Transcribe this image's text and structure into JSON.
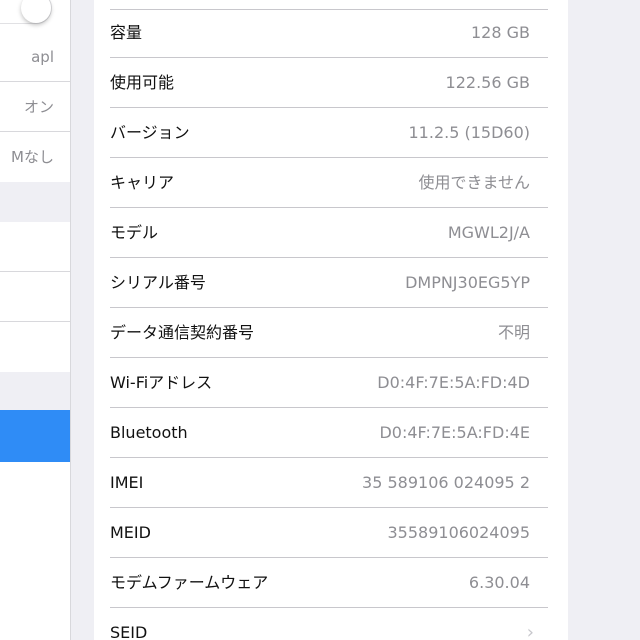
{
  "left_pane": {
    "rows": [
      {
        "value": "apl"
      },
      {
        "value": "オン"
      },
      {
        "value": "Mなし"
      }
    ]
  },
  "about": {
    "rows": [
      {
        "label": "容量",
        "value": "128 GB"
      },
      {
        "label": "使用可能",
        "value": "122.56 GB"
      },
      {
        "label": "バージョン",
        "value": "11.2.5 (15D60)"
      },
      {
        "label": "キャリア",
        "value": "使用できません"
      },
      {
        "label": "モデル",
        "value": "MGWL2J/A"
      },
      {
        "label": "シリアル番号",
        "value": "DMPNJ30EG5YP"
      },
      {
        "label": "データ通信契約番号",
        "value": "不明"
      },
      {
        "label": "Wi-Fiアドレス",
        "value": "D0:4F:7E:5A:FD:4D"
      },
      {
        "label": "Bluetooth",
        "value": "D0:4F:7E:5A:FD:4E"
      },
      {
        "label": "IMEI",
        "value": "35 589106 024095 2"
      },
      {
        "label": "MEID",
        "value": "35589106024095"
      },
      {
        "label": "モデムファームウェア",
        "value": "6.30.04"
      },
      {
        "label": "SEID",
        "value": ""
      }
    ]
  },
  "colors": {
    "background": "#efeff4",
    "selection": "#2f8cf6",
    "value_text": "#8e8e93",
    "separator": "#c8c7cc"
  },
  "icons": {
    "toggle": "toggle-switch",
    "disclosure": "chevron-right-icon"
  }
}
